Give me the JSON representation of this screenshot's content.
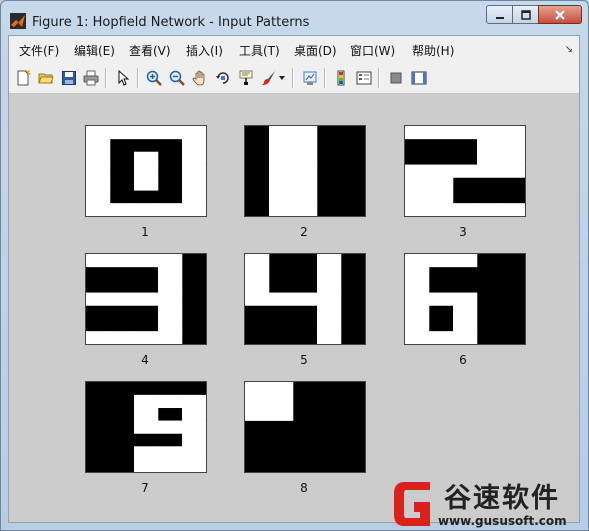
{
  "window": {
    "title": "Figure 1: Hopfield Network - Input Patterns",
    "controls": [
      "minimize-icon",
      "restore-icon",
      "close-icon"
    ]
  },
  "menubar": [
    "文件(F)",
    "编辑(E)",
    "查看(V)",
    "插入(I)",
    "工具(T)",
    "桌面(D)",
    "窗口(W)",
    "帮助(H)"
  ],
  "toolbar": [
    "new-figure-icon",
    "open-file-icon",
    "save-icon",
    "print-icon",
    "edit-plot-arrow-icon",
    "zoom-in-icon",
    "zoom-out-icon",
    "pan-hand-icon",
    "rotate-3d-icon",
    "data-cursor-icon",
    "brush-icon",
    "link-plot-icon",
    "colorbar-icon",
    "legend-icon",
    "hide-plot-tools-icon",
    "show-plot-tools-icon"
  ],
  "patterns": [
    {
      "label": "1",
      "grid": [
        "11111",
        "10001",
        "10101",
        "10101",
        "10101",
        "10001",
        "11111"
      ]
    },
    {
      "label": "2",
      "grid": [
        "01100",
        "01100",
        "01100",
        "01100",
        "01100",
        "01100",
        "01100"
      ]
    },
    {
      "label": "3",
      "grid": [
        "11111",
        "00011",
        "00011",
        "11111",
        "11000",
        "11000",
        "11111"
      ]
    },
    {
      "label": "4",
      "grid": [
        "11110",
        "00010",
        "00010",
        "11110",
        "00010",
        "00010",
        "11110"
      ]
    },
    {
      "label": "5",
      "grid": [
        "10010",
        "10010",
        "10010",
        "11110",
        "00010",
        "00010",
        "00010"
      ]
    },
    {
      "label": "6",
      "grid": [
        "11100",
        "10000",
        "10000",
        "11100",
        "10100",
        "10100",
        "11100"
      ]
    },
    {
      "label": "7",
      "grid": [
        "00000",
        "00111",
        "00101",
        "00111",
        "00001",
        "00111",
        "00111"
      ]
    },
    {
      "label": "8",
      "grid": [
        "11000",
        "11000",
        "11000",
        "00000",
        "00000",
        "00000",
        "00000"
      ]
    }
  ],
  "watermark": {
    "name": "谷速软件",
    "url": "www.gususoft.com",
    "brand_color": "#d9211e"
  }
}
